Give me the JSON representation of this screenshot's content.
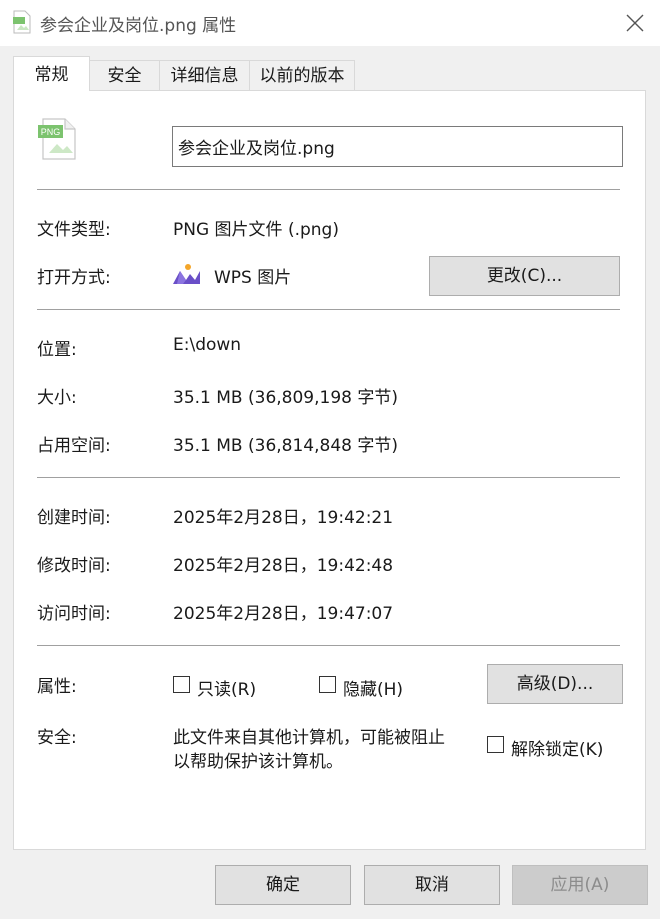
{
  "window": {
    "title": "参会企业及岗位.png 属性"
  },
  "tabs": [
    {
      "label": "常规"
    },
    {
      "label": "安全"
    },
    {
      "label": "详细信息"
    },
    {
      "label": "以前的版本"
    }
  ],
  "file": {
    "icon_text": "PNG",
    "name": "参会企业及岗位.png"
  },
  "general": {
    "type_label": "文件类型:",
    "type_value": "PNG 图片文件 (.png)",
    "open_label": "打开方式:",
    "open_value": "WPS 图片",
    "change_button": "更改(C)...",
    "location_label": "位置:",
    "location_value": "E:\\down",
    "size_label": "大小:",
    "size_value": "35.1 MB (36,809,198 字节)",
    "disk_label": "占用空间:",
    "disk_value": "35.1 MB (36,814,848 字节)",
    "created_label": "创建时间:",
    "created_value": "2025年2月28日，19:42:21",
    "modified_label": "修改时间:",
    "modified_value": "2025年2月28日，19:42:48",
    "accessed_label": "访问时间:",
    "accessed_value": "2025年2月28日，19:47:07",
    "attributes_label": "属性:",
    "readonly_label": "只读(R)",
    "hidden_label": "隐藏(H)",
    "advanced_button": "高级(D)...",
    "security_label": "安全:",
    "security_text_line1": "此文件来自其他计算机，可能被阻止",
    "security_text_line2": "以帮助保护该计算机。",
    "unblock_label": "解除锁定(K)"
  },
  "footer": {
    "ok": "确定",
    "cancel": "取消",
    "apply": "应用(A)"
  },
  "colors": {
    "separator": "#a0a0a0",
    "disabled_text": "#8c8c8c",
    "png_icon_green": "#7cc36e"
  }
}
